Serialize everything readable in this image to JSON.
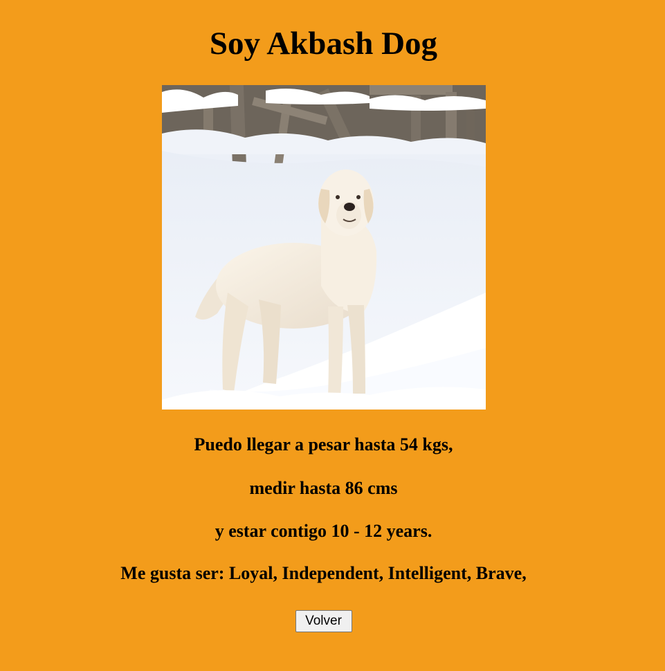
{
  "page": {
    "title": "Soy Akbash Dog",
    "background_color": "#F39C1B"
  },
  "dog_photo": {
    "alt": "Akbash Dog"
  },
  "info": {
    "weight_line": "Puedo llegar a pesar hasta 54 kgs,",
    "height_line": "medir hasta 86 cms",
    "lifespan_line": "y estar contigo 10 - 12 years.",
    "temperament_line": "Me gusta ser: Loyal, Independent, Intelligent, Brave,"
  },
  "actions": {
    "back_label": "Volver"
  }
}
